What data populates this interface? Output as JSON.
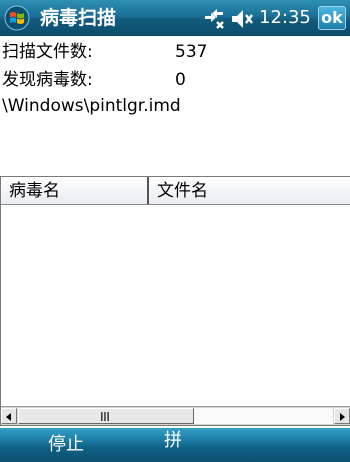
{
  "titlebar": {
    "app_title": "病毒扫描",
    "time": "12:35",
    "ok_label": "ok",
    "start_icon": "windows-logo-icon",
    "connectivity_icon": "connectivity-icon",
    "volume_icon": "volume-icon"
  },
  "scan_info": {
    "files_scanned_label": "扫描文件数:",
    "files_scanned_value": "537",
    "viruses_found_label": "发现病毒数:",
    "viruses_found_value": "0",
    "current_file": "\\Windows\\pintlgr.imd"
  },
  "results_list": {
    "columns": [
      "病毒名",
      "文件名"
    ],
    "rows": []
  },
  "menubar": {
    "left_softkey": "停止",
    "right_softkey": "拼"
  },
  "colors": {
    "titlebar": "#1a6f95",
    "menubar": "#1a78a0",
    "text": "#000000"
  }
}
